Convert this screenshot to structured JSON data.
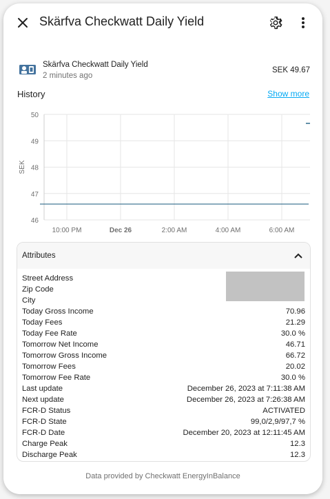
{
  "dialog": {
    "title": "Skärfva Checkwatt Daily Yield"
  },
  "entity": {
    "name": "Skärfva Checkwatt Daily Yield",
    "last_changed": "2 minutes ago",
    "state": "SEK 49.67",
    "icon": "solar-power-icon"
  },
  "history": {
    "title": "History",
    "show_more_label": "Show more"
  },
  "chart_data": {
    "type": "line",
    "ylabel": "SEK",
    "ylim": [
      46,
      50
    ],
    "y_ticks": [
      "50",
      "49",
      "48",
      "47",
      "46"
    ],
    "x_ticks": [
      "10:00 PM",
      "Dec 26",
      "2:00 AM",
      "4:00 AM",
      "6:00 AM"
    ],
    "x": [
      "9:00 PM",
      "7:00 AM"
    ],
    "series": [
      {
        "values": [
          46.6,
          46.6
        ]
      }
    ]
  },
  "attributes": {
    "title": "Attributes",
    "rows": [
      {
        "label": "Street Address",
        "value": ""
      },
      {
        "label": "Zip Code",
        "value": ""
      },
      {
        "label": "City",
        "value": ""
      },
      {
        "label": "Today Gross Income",
        "value": "70.96"
      },
      {
        "label": "Today Fees",
        "value": "21.29"
      },
      {
        "label": "Today Fee Rate",
        "value": "30.0 %"
      },
      {
        "label": "Tomorrow Net Income",
        "value": "46.71"
      },
      {
        "label": "Tomorrow Gross Income",
        "value": "66.72"
      },
      {
        "label": "Tomorrow Fees",
        "value": "20.02"
      },
      {
        "label": "Tomorrow Fee Rate",
        "value": "30.0 %"
      },
      {
        "label": "Last update",
        "value": "December 26, 2023 at 7:11:38 AM"
      },
      {
        "label": "Next update",
        "value": "December 26, 2023 at 7:26:38 AM"
      },
      {
        "label": "FCR-D Status",
        "value": "ACTIVATED"
      },
      {
        "label": "FCR-D State",
        "value": "99,0/2,9/97,7 %"
      },
      {
        "label": "FCR-D Date",
        "value": "December 20, 2023 at 12:11:45 AM"
      },
      {
        "label": "Charge Peak",
        "value": "12.3"
      },
      {
        "label": "Discharge Peak",
        "value": "12.3"
      }
    ]
  },
  "footer": {
    "text": "Data provided by Checkwatt EnergyInBalance"
  },
  "colors": {
    "accent": "#03a9f4",
    "line": "#2f6a8a",
    "icon": "#44739e"
  }
}
